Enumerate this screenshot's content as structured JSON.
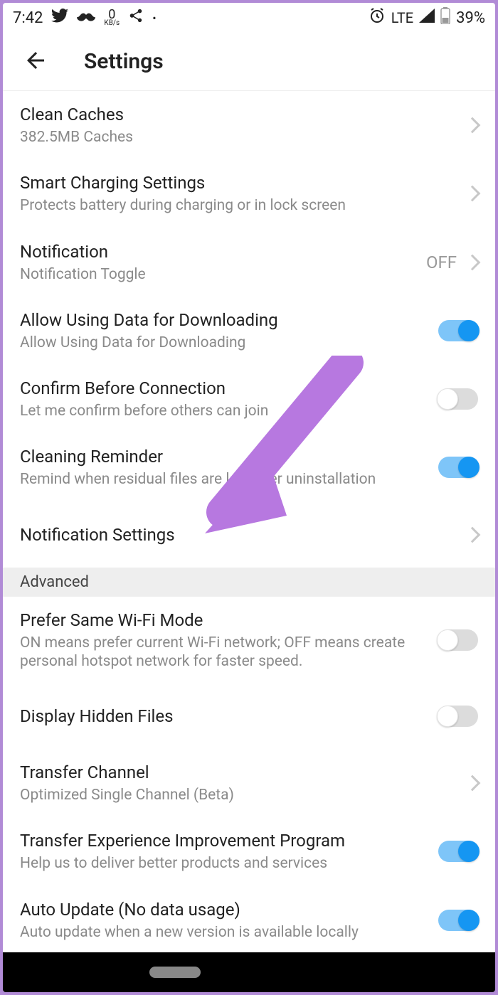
{
  "status": {
    "time": "7:42",
    "kbps_value": "0",
    "kbps_unit": "KB/s",
    "lte": "LTE",
    "battery_pct": "39%"
  },
  "header": {
    "title": "Settings"
  },
  "rows": [
    {
      "title": "Clean Caches",
      "sub": "382.5MB Caches",
      "type": "nav"
    },
    {
      "title": "Smart Charging Settings",
      "sub": "Protects battery during charging or in lock screen",
      "type": "nav"
    },
    {
      "title": "Notification",
      "sub": "Notification Toggle",
      "type": "nav_value",
      "value": "OFF"
    },
    {
      "title": "Allow Using Data for Downloading",
      "sub": "Allow Using Data for Downloading",
      "type": "toggle",
      "on": true
    },
    {
      "title": "Confirm Before Connection",
      "sub": "Let me confirm before others can join",
      "type": "toggle",
      "on": false
    },
    {
      "title": "Cleaning Reminder",
      "sub": "Remind when residual files are left after uninstallation",
      "type": "toggle",
      "on": true
    },
    {
      "title": "Notification Settings",
      "sub": "",
      "type": "nav"
    }
  ],
  "section": "Advanced",
  "rows2": [
    {
      "title": "Prefer Same Wi-Fi Mode",
      "sub": "ON means prefer current Wi-Fi network; OFF means create personal hotspot network for faster speed.",
      "type": "toggle",
      "on": false
    },
    {
      "title": "Display Hidden Files",
      "sub": "",
      "type": "toggle",
      "on": false
    },
    {
      "title": "Transfer Channel",
      "sub": "Optimized Single Channel (Beta)",
      "type": "nav"
    },
    {
      "title": "Transfer Experience Improvement Program",
      "sub": "Help us to deliver better products and services",
      "type": "toggle",
      "on": true
    },
    {
      "title": "Auto Update (No data usage)",
      "sub": "Auto update when a new version is available locally",
      "type": "toggle",
      "on": true
    }
  ],
  "annotation": {
    "arrow_color": "#b778e0"
  }
}
